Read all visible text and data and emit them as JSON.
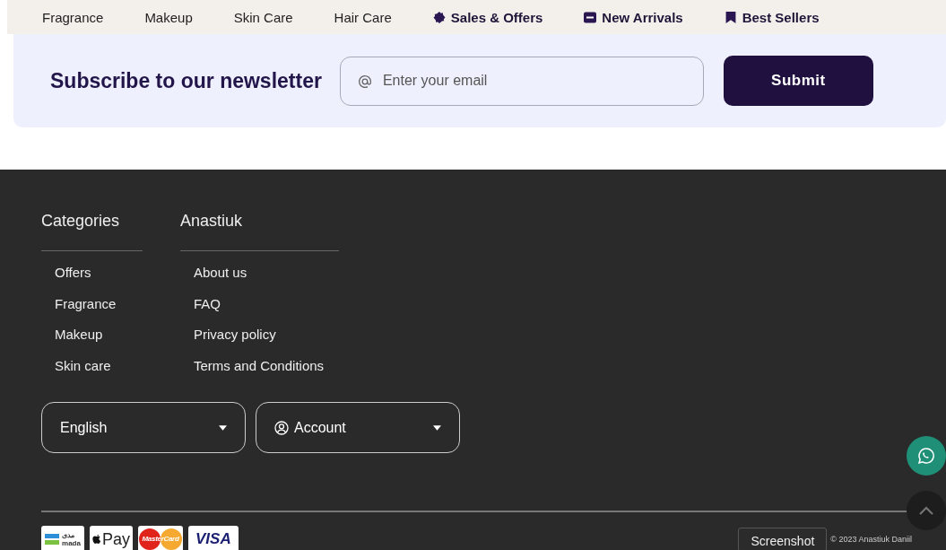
{
  "nav": [
    {
      "label": "Fragrance",
      "kind": "plain"
    },
    {
      "label": "Makeup",
      "kind": "plain"
    },
    {
      "label": "Skin Care",
      "kind": "plain"
    },
    {
      "label": "Hair Care",
      "kind": "plain"
    },
    {
      "label": "Sales & Offers",
      "kind": "sale"
    },
    {
      "label": "New Arrivals",
      "kind": "new"
    },
    {
      "label": "Best Sellers",
      "kind": "best"
    }
  ],
  "newsletter": {
    "title": "Subscribe to our newsletter",
    "email_placeholder": "Enter your email",
    "submit": "Submit"
  },
  "footer": {
    "columns": [
      {
        "title": "Categories",
        "links": [
          "Offers",
          "Fragrance",
          "Makeup",
          "Skin care"
        ]
      },
      {
        "title": "Anastiuk",
        "links": [
          "About us",
          "FAQ",
          "Privacy policy",
          "Terms and Conditions"
        ]
      }
    ],
    "language": "English",
    "account": "Account",
    "payments": [
      {
        "kind": "mada",
        "label": "mada",
        "arabic": "مدى"
      },
      {
        "kind": "applepay",
        "label": "Pay"
      },
      {
        "kind": "mastercard",
        "label": "MasterCard"
      },
      {
        "kind": "visa",
        "label": "VISA"
      }
    ],
    "tooltip": "Screenshot",
    "copyright": "© 2023 Anastiuk Daniil"
  }
}
